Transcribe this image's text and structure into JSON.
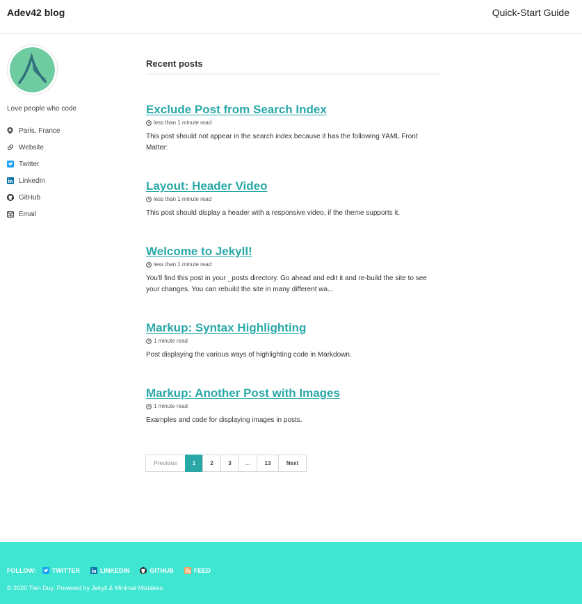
{
  "masthead": {
    "site_title": "Adev42 blog",
    "nav_link": "Quick-Start Guide"
  },
  "author": {
    "bio": "Love people who code",
    "links": [
      {
        "label": "Paris, France",
        "icon": "map-marker-icon"
      },
      {
        "label": "Website",
        "icon": "link-icon"
      },
      {
        "label": "Twitter",
        "icon": "twitter-icon"
      },
      {
        "label": "LinkedIn",
        "icon": "linkedin-icon"
      },
      {
        "label": "GitHub",
        "icon": "github-icon"
      },
      {
        "label": "Email",
        "icon": "envelope-icon"
      }
    ]
  },
  "main": {
    "section_title": "Recent posts",
    "posts": [
      {
        "title": "Exclude Post from Search Index",
        "read_time": "less than 1 minute read",
        "excerpt": "This post should not appear in the search index because it has the following YAML Front Matter:"
      },
      {
        "title": "Layout: Header Video",
        "read_time": "less than 1 minute read",
        "excerpt": "This post should display a header with a responsive video, if the theme supports it."
      },
      {
        "title": "Welcome to Jekyll!",
        "read_time": "less than 1 minute read",
        "excerpt": "You'll find this post in your _posts directory. Go ahead and edit it and re-build the site to see your changes. You can rebuild the site in many different wa..."
      },
      {
        "title": "Markup: Syntax Highlighting",
        "read_time": "1 minute read",
        "excerpt": "Post displaying the various ways of highlighting code in Markdown."
      },
      {
        "title": "Markup: Another Post with Images",
        "read_time": "1 minute read",
        "excerpt": "Examples and code for displaying images in posts."
      }
    ]
  },
  "pagination": {
    "previous": "Previous",
    "pages": [
      "1",
      "2",
      "3",
      "...",
      "13"
    ],
    "next": "Next"
  },
  "footer": {
    "follow_label": "FOLLOW:",
    "links": [
      {
        "label": "TWITTER",
        "icon": "twitter-icon"
      },
      {
        "label": "LINKEDIN",
        "icon": "linkedin-icon"
      },
      {
        "label": "GITHUB",
        "icon": "github-icon"
      },
      {
        "label": "FEED",
        "icon": "rss-icon"
      }
    ],
    "copyright": "© 2020 Tien Duy. Powered by Jekyll & Minimal Mistakes."
  },
  "colors": {
    "accent": "#2aa8a8",
    "footer_bg": "#3fe6d2",
    "avatar_bg": "#6fcba0"
  }
}
